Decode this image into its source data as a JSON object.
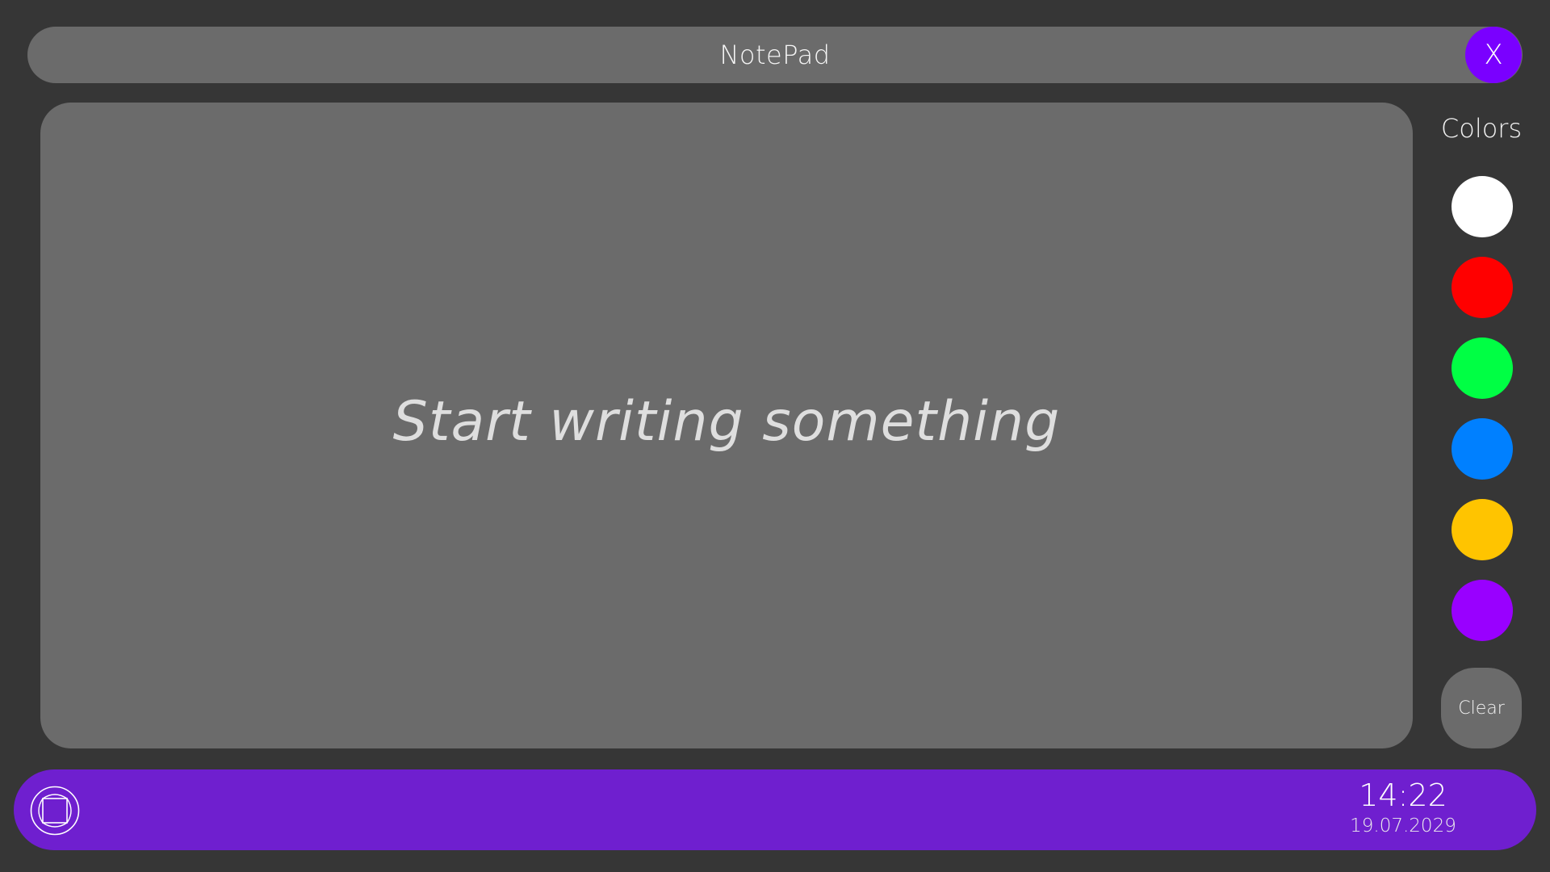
{
  "window": {
    "title": "NotePad",
    "close_label": "X",
    "close_color": "#7a00ff"
  },
  "editor": {
    "placeholder": "Start writing something",
    "value": ""
  },
  "colors_panel": {
    "label": "Colors",
    "swatches": [
      {
        "name": "white",
        "hex": "#ffffff"
      },
      {
        "name": "red",
        "hex": "#ff0000"
      },
      {
        "name": "green",
        "hex": "#00ff44"
      },
      {
        "name": "blue",
        "hex": "#0080ff"
      },
      {
        "name": "yellow",
        "hex": "#ffc400"
      },
      {
        "name": "purple",
        "hex": "#9900ff"
      }
    ],
    "clear_label": "Clear"
  },
  "taskbar": {
    "background": "#6f1fcf",
    "start_icon": "window-square-icon",
    "time": "14:22",
    "date": "19.07.2029"
  },
  "theme": {
    "background": "#363636",
    "panel": "#6b6b6b"
  }
}
